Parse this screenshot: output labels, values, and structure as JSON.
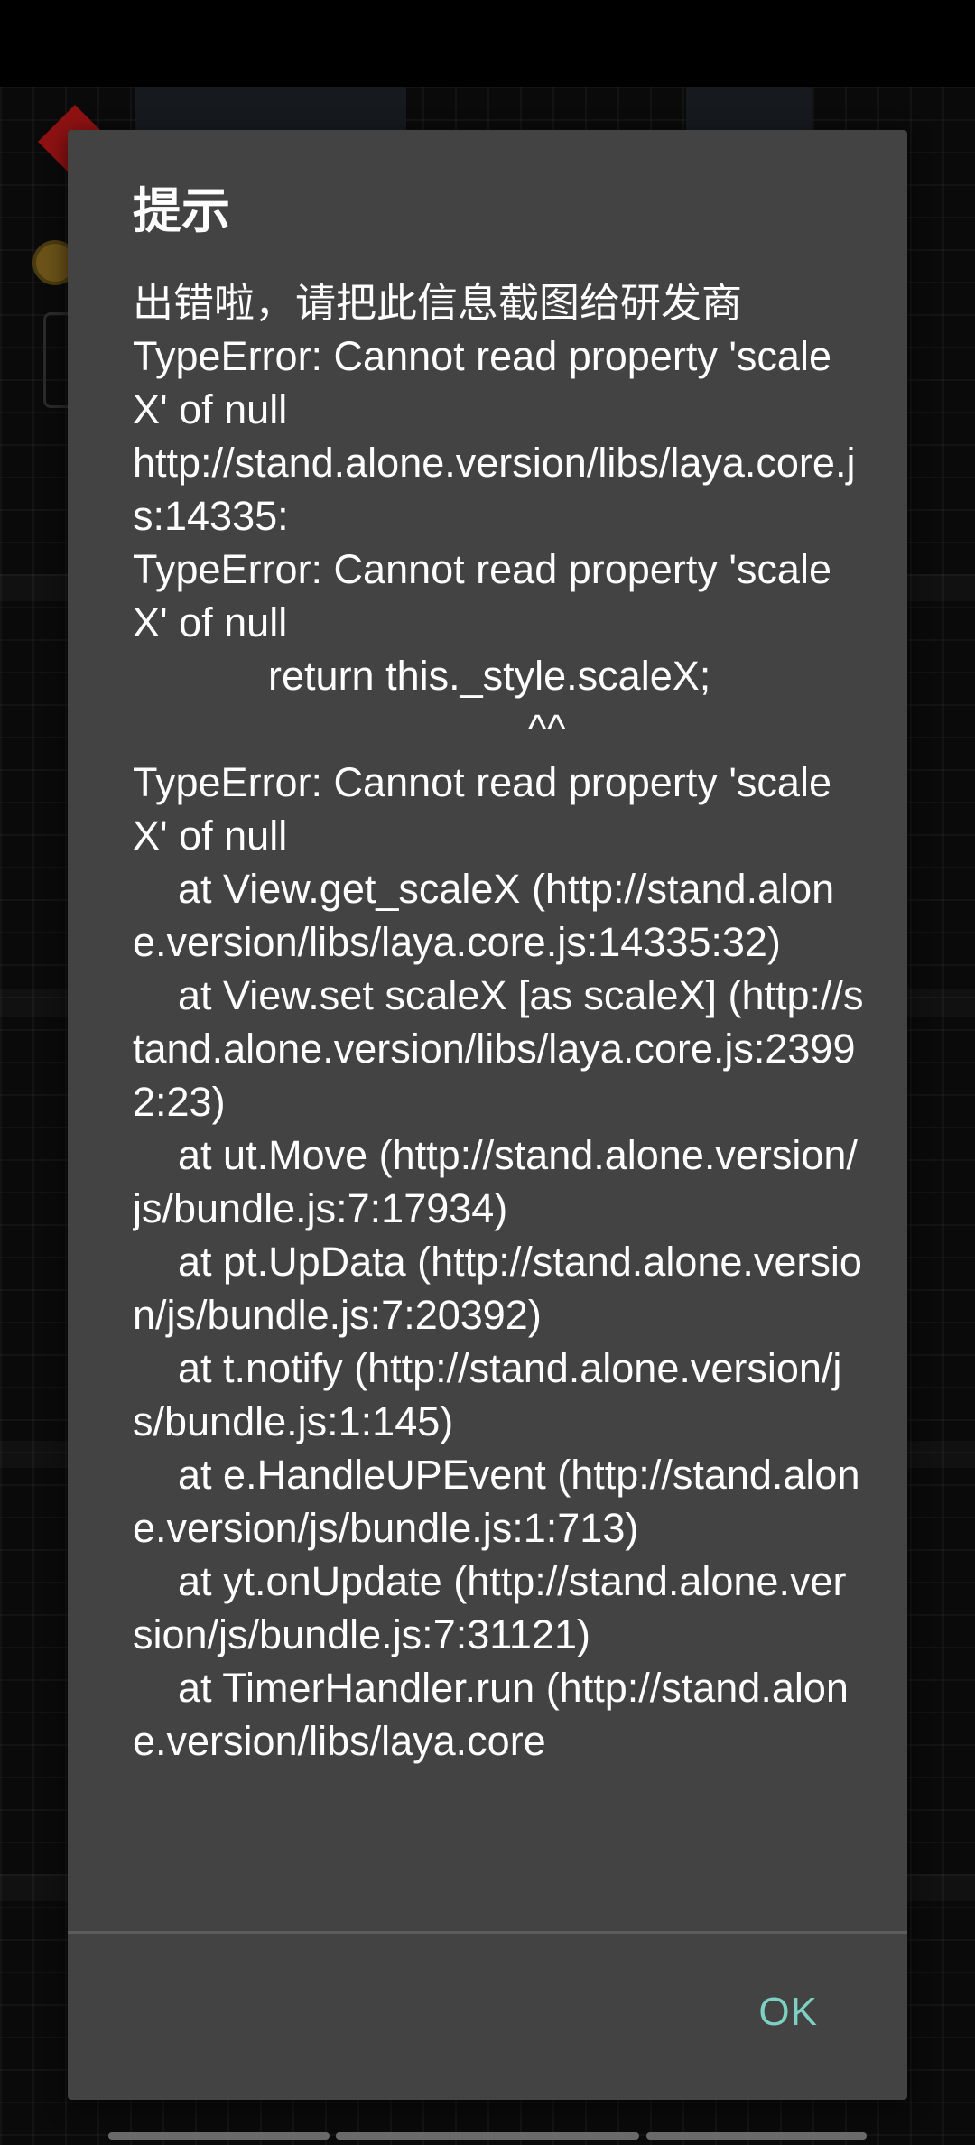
{
  "dialog": {
    "title": "提示",
    "message": "出错啦，请把此信息截图给研发商\nTypeError: Cannot read property 'scaleX' of null\nhttp://stand.alone.version/libs/laya.core.js:14335:\nTypeError: Cannot read property 'scaleX' of null\n            return this._style.scaleX;\n                                   ^^\nTypeError: Cannot read property 'scaleX' of null\n    at View.get_scaleX (http://stand.alone.version/libs/laya.core.js:14335:32)\n    at View.set scaleX [as scaleX] (http://stand.alone.version/libs/laya.core.js:23992:23)\n    at ut.Move (http://stand.alone.version/js/bundle.js:7:17934)\n    at pt.UpData (http://stand.alone.version/js/bundle.js:7:20392)\n    at t.notify (http://stand.alone.version/js/bundle.js:1:145)\n    at e.HandleUPEvent (http://stand.alone.version/js/bundle.js:1:713)\n    at yt.onUpdate (http://stand.alone.version/js/bundle.js:7:31121)\n    at TimerHandler.run (http://stand.alone.version/libs/laya.core",
    "ok_label": "OK"
  },
  "colors": {
    "dialog_background": "#434343",
    "ok_accent": "#7dd1c2",
    "backdrop": "#000000"
  }
}
